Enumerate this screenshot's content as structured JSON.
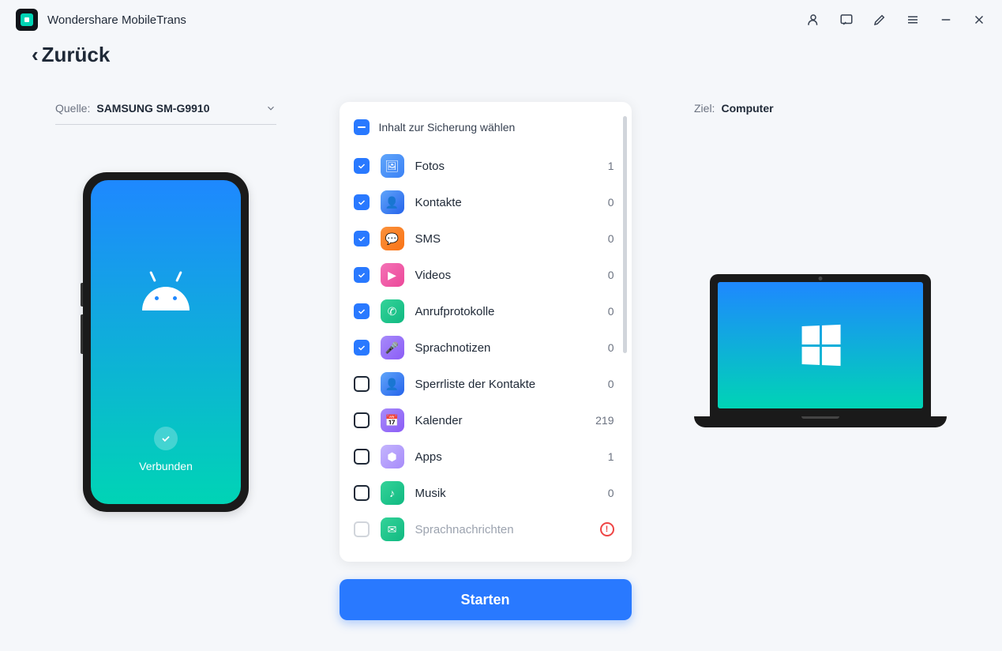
{
  "app": {
    "title": "Wondershare MobileTrans"
  },
  "nav": {
    "back": "Zurück"
  },
  "source": {
    "label": "Quelle:",
    "device": "SAMSUNG SM-G9910",
    "status": "Verbunden"
  },
  "target": {
    "label": "Ziel:",
    "device": "Computer"
  },
  "list": {
    "header": "Inhalt zur Sicherung wählen",
    "items": [
      {
        "label": "Fotos",
        "count": "1",
        "checked": true,
        "iconClass": "ic-blue",
        "glyph": "🖼"
      },
      {
        "label": "Kontakte",
        "count": "0",
        "checked": true,
        "iconClass": "ic-contact",
        "glyph": "👤"
      },
      {
        "label": "SMS",
        "count": "0",
        "checked": true,
        "iconClass": "ic-orange",
        "glyph": "💬"
      },
      {
        "label": "Videos",
        "count": "0",
        "checked": true,
        "iconClass": "ic-pink",
        "glyph": "▶"
      },
      {
        "label": "Anrufprotokolle",
        "count": "0",
        "checked": true,
        "iconClass": "ic-green",
        "glyph": "✆"
      },
      {
        "label": "Sprachnotizen",
        "count": "0",
        "checked": true,
        "iconClass": "ic-purple",
        "glyph": "🎤"
      },
      {
        "label": "Sperrliste der Kontakte",
        "count": "0",
        "checked": false,
        "iconClass": "ic-contact",
        "glyph": "👤"
      },
      {
        "label": "Kalender",
        "count": "219",
        "checked": false,
        "iconClass": "ic-purple",
        "glyph": "📅"
      },
      {
        "label": "Apps",
        "count": "1",
        "checked": false,
        "iconClass": "ic-lav",
        "glyph": "⬢"
      },
      {
        "label": "Musik",
        "count": "0",
        "checked": false,
        "iconClass": "ic-green",
        "glyph": "♪"
      },
      {
        "label": "Sprachnachrichten",
        "count": "",
        "checked": false,
        "disabled": true,
        "warning": true,
        "iconClass": "ic-green",
        "glyph": "✉"
      }
    ]
  },
  "action": {
    "start": "Starten"
  }
}
